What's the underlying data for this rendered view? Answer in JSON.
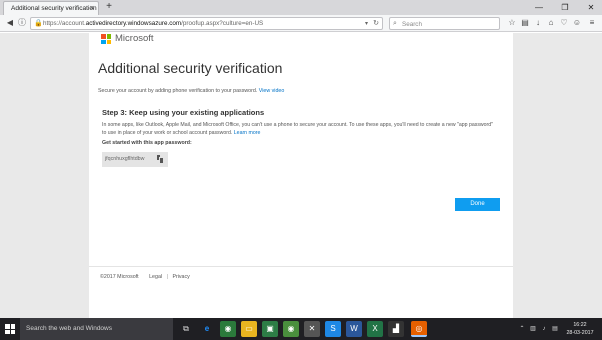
{
  "browser": {
    "tab_title": "Additional security verification",
    "tab_close": "×",
    "new_tab": "+",
    "url_prefix": "https://account.",
    "url_domain": "activedirectory.windowsazure.com",
    "url_path": "/proofup.aspx?culture=en-US",
    "search_placeholder": "Search",
    "window_controls": {
      "minimize": "—",
      "restore": "❐",
      "close": "✕"
    }
  },
  "page": {
    "brand": "Microsoft",
    "title": "Additional security verification",
    "intro_text": "Secure your account by adding phone verification to your password.",
    "intro_link": "View video",
    "step_title": "Step 3: Keep using your existing applications",
    "step_paragraph": "In some apps, like Outlook, Apple Mail, and Microsoft Office, you can't use a phone to secure your account. To use these apps, you'll need to create a new \"app password\" to use in place of your work or school account password.",
    "learn_more": "Learn more",
    "get_started_label": "Get started with this app password:",
    "app_password": "jfqcnhuxgflhtdbw",
    "done_button": "Done",
    "footer": {
      "copyright": "©2017 Microsoft",
      "legal": "Legal",
      "separator": "|",
      "privacy": "Privacy"
    }
  },
  "taskbar": {
    "search_text": "Search the web and Windows",
    "time": "16:22",
    "date": "28-03-2017"
  },
  "colors": {
    "done_button": "#0f9df0",
    "link": "#0072c6",
    "ms_red": "#f25022",
    "ms_green": "#7fba00",
    "ms_blue": "#00a4ef",
    "ms_yellow": "#ffb900",
    "taskbar": "#1f1f23"
  }
}
